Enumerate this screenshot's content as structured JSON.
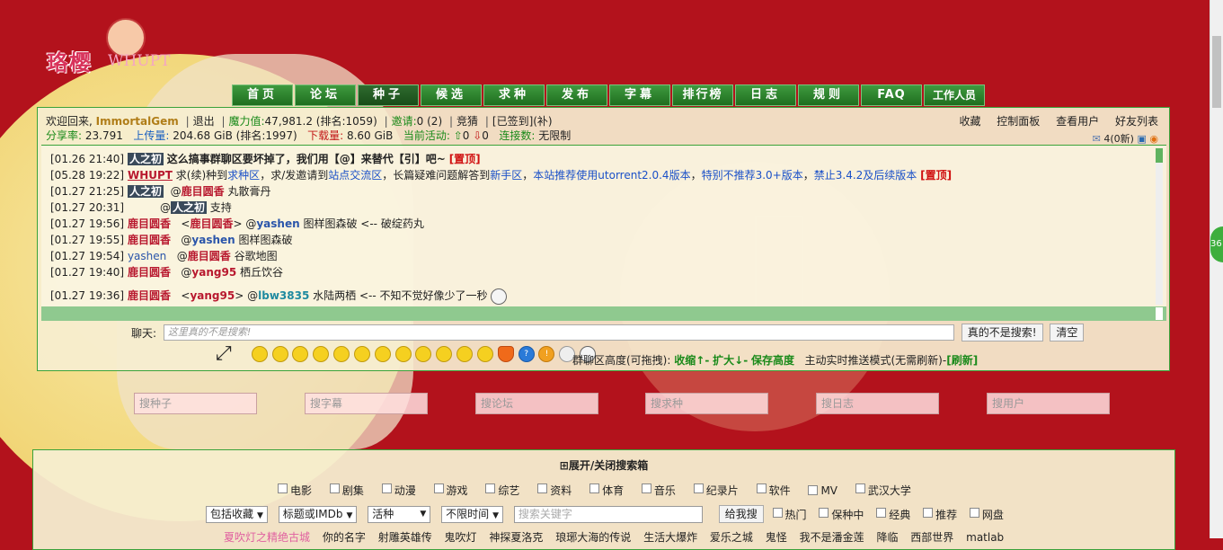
{
  "site": {
    "logo_text": "珞樱",
    "logo_sub": "WHUPT"
  },
  "nav": [
    "首页",
    "论坛",
    "种子",
    "候选",
    "求种",
    "发布",
    "字幕",
    "排行榜",
    "日志",
    "规则",
    "FAQ",
    "工作人员"
  ],
  "nav_active": 2,
  "user": {
    "welcome": "欢迎回来,",
    "name": "ImmortalGem",
    "logout": "退出",
    "power_label": "魔力值:",
    "power_value": "47,981.2 (排名:1059)",
    "invite_label": "邀请:",
    "invite_value": "0 (2)",
    "bid": "竞猜",
    "signed": "[已签到](补)",
    "ratio_label": "分享率:",
    "ratio_value": "23.791",
    "upload_label": "上传量:",
    "upload_value": "204.68 GiB (排名:1997)",
    "download_label": "下载量:",
    "download_value": "8.60 GiB",
    "activity_label": "当前活动:",
    "activity_up": "0",
    "activity_down": "0",
    "conn_label": "连接数:",
    "conn_value": "无限制"
  },
  "user_links": [
    "收藏",
    "控制面板",
    "查看用户",
    "好友列表"
  ],
  "messages": {
    "count": "4(0新)"
  },
  "chat": [
    {
      "time": "[01.26 21:40]",
      "user": "人之初",
      "style": "blk",
      "text": "这么搞事群聊区要坏掉了，我们用【@】来替代【引】吧~",
      "tag": "[置顶]"
    },
    {
      "time": "[05.28 19:22]",
      "user": "WHUPT",
      "style": "red",
      "pre": "求(续)种到",
      "l1": "求种区",
      "m1": "，求/发邀请到",
      "l2": "站点交流区",
      "m2": "，长篇疑难问题解答到",
      "l3": "新手区",
      "m3": "，",
      "l4": "本站推荐使用utorrent2.0.4版本",
      "m4": "，",
      "l5": "特别不推荐3.0+版本",
      "m5": "，",
      "l6": "禁止3.4.2及后续版本",
      "tag": "[置顶]"
    },
    {
      "time": "[01.27 21:25]",
      "user": "人之初",
      "style": "blk",
      "at": "鹿目圆香",
      "text": "丸散膏丹"
    },
    {
      "time": "[01.27 20:31]",
      "user": "",
      "style": "none",
      "at": "人之初",
      "text": "支持"
    },
    {
      "time": "[01.27 19:56]",
      "user": "鹿目圆香",
      "style": "red",
      "quote": "鹿目圆香",
      "at": "yashen",
      "text": "图样图森破  <-- 破绽药丸"
    },
    {
      "time": "[01.27 19:55]",
      "user": "鹿目圆香",
      "style": "red",
      "at": "yashen",
      "text": "图样图森破"
    },
    {
      "time": "[01.27 19:54]",
      "user": "yashen",
      "style": "blue",
      "at": "鹿目圆香",
      "text": "谷歌地图"
    },
    {
      "time": "[01.27 19:40]",
      "user": "鹿目圆香",
      "style": "red",
      "at": "yang95",
      "text": "栖丘饮谷"
    },
    {
      "time": "[01.27 19:36]",
      "user": "鹿目圆香",
      "style": "red",
      "quote": "yang95",
      "at": "lbw3835",
      "text": "水陆两栖  <-- 不知不觉好像少了一秒"
    }
  ],
  "chat_input": {
    "label": "聊天:",
    "placeholder": "这里真的不是搜索!",
    "send": "真的不是搜索!",
    "clear": "清空"
  },
  "chat_height": {
    "label": "群聊区高度(可拖拽):",
    "shrink": "收缩",
    "expand": "扩大",
    "save": "保存高度",
    "mode": "主动实时推送模式(无需刷新)-",
    "refresh": "[刷新]"
  },
  "search_boxes": [
    "搜种子",
    "搜字幕",
    "搜论坛",
    "搜求种",
    "搜日志",
    "搜用户"
  ],
  "search_panel": {
    "toggle": "展开/关闭搜索箱",
    "categories": [
      "电影",
      "剧集",
      "动漫",
      "游戏",
      "综艺",
      "资料",
      "体育",
      "音乐",
      "纪录片",
      "软件",
      "MV",
      "武汉大学"
    ],
    "selects": [
      "包括收藏",
      "标题或IMDb",
      "活种",
      "不限时间"
    ],
    "keyword_placeholder": "搜索关键字",
    "search_btn": "给我搜",
    "options": [
      "热门",
      "保种中",
      "经典",
      "推荐",
      "网盘"
    ],
    "hot": [
      "夏吹灯之精绝古城",
      "你的名字",
      "射雕英雄传",
      "鬼吹灯",
      "神探夏洛克",
      "琅琊大海的传说",
      "生活大爆炸",
      "爱乐之城",
      "鬼怪",
      "我不是潘金莲",
      "降临",
      "西部世界",
      "matlab"
    ]
  },
  "side_badge": "36"
}
